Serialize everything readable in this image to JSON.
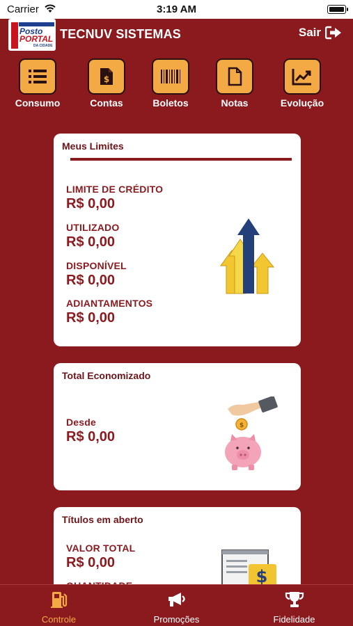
{
  "status": {
    "carrier": "Carrier",
    "time": "3:19 AM"
  },
  "header": {
    "logo_line1": "Posto",
    "logo_line2": "PORTAL",
    "logo_line3": "DA CIDADE",
    "title": "TECNUV SISTEMAS",
    "logout_label": "Sair"
  },
  "menu": {
    "items": [
      {
        "label": "Consumo",
        "icon": "list-icon"
      },
      {
        "label": "Contas",
        "icon": "invoice-dollar-icon"
      },
      {
        "label": "Boletos",
        "icon": "barcode-icon"
      },
      {
        "label": "Notas",
        "icon": "document-icon"
      },
      {
        "label": "Evolução",
        "icon": "chart-line-icon"
      }
    ]
  },
  "limits": {
    "title": "Meus Limites",
    "credit_label": "LIMITE DE CRÉDITO",
    "credit_value": "R$ 0,00",
    "used_label": "UTILIZADO",
    "used_value": "R$ 0,00",
    "available_label": "DISPONÍVEL",
    "available_value": "R$ 0,00",
    "advances_label": "ADIANTAMENTOS",
    "advances_value": "R$ 0,00"
  },
  "savings": {
    "title": "Total Economizado",
    "since_label": "Desde",
    "since_value": "R$ 0,00"
  },
  "titles": {
    "title": "Títulos em aberto",
    "total_label": "VALOR TOTAL",
    "total_value": "R$ 0,00",
    "quantity_label": "QUANTIDADE"
  },
  "tabbar": {
    "items": [
      {
        "label": "Controle",
        "icon": "fuel-pump-icon",
        "active": true
      },
      {
        "label": "Promoções",
        "icon": "megaphone-icon",
        "active": false
      },
      {
        "label": "Fidelidade",
        "icon": "trophy-icon",
        "active": false
      }
    ]
  },
  "colors": {
    "background": "#8b1a1f",
    "accent": "#f3aa45",
    "card": "#ffffff",
    "text_on_card": "#8b1a1f"
  }
}
